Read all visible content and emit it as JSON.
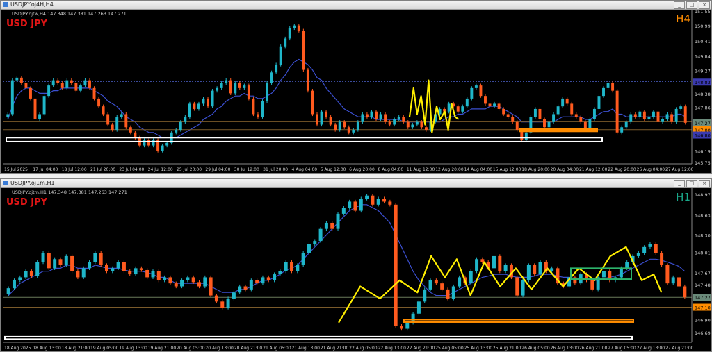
{
  "windows": [
    {
      "title": "USDJPY.oj4H,H4",
      "info": "USDJPY.ojtw,H4  147.348 147.381 147.263 147.271",
      "symbol": "USD JPY",
      "timeframe": "H4",
      "tf_color": "#ff8c00",
      "price_labels": [
        "151.550",
        "150.990",
        "150.410",
        "149.840",
        "149.270",
        "148.830",
        "148.380",
        "147.860",
        "147.310",
        "147.271",
        "147.006",
        "146.800",
        "146.190",
        "145.750"
      ],
      "time_labels": [
        "15 Jul 2025",
        "17 Jul 04:00",
        "18 Jul 12:00",
        "21 Jul 20:00",
        "23 Jul 04:00",
        "24 Jul 12:00",
        "25 Jul 20:00",
        "29 Jul 04:00",
        "30 Jul 12:00",
        "31 Jul 20:00",
        "4 Aug 04:00",
        "5 Aug 12:00",
        "6 Aug 20:00",
        "8 Aug 04:00",
        "11 Aug 12:00",
        "12 Aug 20:00",
        "14 Aug 04:00",
        "15 Aug 12:00",
        "18 Aug 20:00",
        "20 Aug 04:00",
        "21 Aug 12:00",
        "22 Aug 20:00",
        "26 Aug 04:00",
        "27 Aug 12:00"
      ],
      "window_buttons": [
        "_",
        "□",
        "×"
      ]
    },
    {
      "title": "USDJPY.oj1m,H1",
      "info": "USDJPY.ojtm,H1  147.348 147.381 147.263 147.271",
      "symbol": "USD JPY",
      "timeframe": "H1",
      "tf_color": "#1aa88a",
      "price_labels": [
        "148.970",
        "148.630",
        "148.300",
        "148.010",
        "147.675",
        "147.480",
        "147.271",
        "147.106",
        "146.900",
        "146.690"
      ],
      "time_labels": [
        "18 Aug 2025",
        "18 Aug 13:00",
        "18 Aug 21:00",
        "19 Aug 05:00",
        "19 Aug 13:00",
        "19 Aug 21:00",
        "20 Aug 05:00",
        "20 Aug 13:00",
        "20 Aug 21:00",
        "21 Aug 05:00",
        "21 Aug 13:00",
        "21 Aug 21:00",
        "22 Aug 05:00",
        "22 Aug 13:00",
        "22 Aug 21:00",
        "25 Aug 05:00",
        "25 Aug 13:00",
        "25 Aug 21:00",
        "26 Aug 05:00",
        "26 Aug 13:00",
        "26 Aug 21:00",
        "27 Aug 05:00",
        "27 Aug 13:00",
        "27 Aug 21:00"
      ],
      "window_buttons": [
        "_",
        "□",
        "×"
      ]
    }
  ],
  "chart_data": [
    {
      "type": "candlestick",
      "title": "USD JPY",
      "timeframe": "H4",
      "ylim": [
        145.75,
        151.55
      ],
      "closes": [
        147.6,
        148.9,
        149.0,
        148.8,
        148.6,
        148.2,
        147.4,
        147.6,
        148.3,
        148.7,
        148.9,
        148.8,
        148.6,
        148.9,
        148.8,
        148.5,
        148.7,
        148.9,
        148.6,
        148.2,
        147.9,
        147.6,
        147.2,
        147.0,
        147.5,
        147.6,
        147.1,
        146.9,
        146.7,
        146.4,
        146.6,
        146.4,
        146.6,
        146.2,
        146.4,
        146.5,
        146.9,
        147.0,
        147.3,
        147.5,
        148.0,
        147.8,
        148.0,
        148.2,
        147.9,
        148.5,
        148.6,
        148.8,
        148.9,
        148.4,
        148.8,
        148.6,
        148.7,
        148.2,
        147.6,
        147.5,
        148.1,
        148.8,
        149.2,
        149.5,
        150.2,
        150.5,
        150.9,
        151.0,
        150.8,
        149.3,
        148.5,
        147.6,
        147.2,
        147.7,
        147.5,
        147.2,
        147.0,
        147.3,
        147.1,
        146.9,
        147.0,
        147.3,
        147.6,
        147.5,
        147.7,
        147.4,
        147.6,
        147.3,
        147.2,
        147.4,
        147.5,
        147.3,
        147.1,
        147.2,
        147.3,
        147.1,
        147.0,
        147.3,
        147.6,
        147.8,
        147.7,
        148.0,
        147.9,
        147.7,
        147.9,
        148.2,
        148.6,
        148.7,
        148.3,
        148.0,
        147.9,
        148.0,
        147.8,
        147.6,
        147.5,
        147.3,
        147.0,
        146.6,
        146.9,
        147.5,
        147.8,
        147.4,
        147.1,
        147.3,
        147.6,
        147.9,
        148.2,
        148.0,
        147.6,
        147.5,
        147.3,
        147.0,
        147.4,
        147.8,
        148.3,
        148.6,
        148.8,
        148.5,
        146.9,
        147.1,
        147.3,
        147.6,
        147.5,
        147.7,
        147.4,
        147.5,
        147.7,
        147.3,
        147.4,
        147.6,
        147.3,
        147.8,
        147.9,
        147.271
      ],
      "ma": [
        147.4,
        147.9,
        148.3,
        148.5,
        148.6,
        148.6,
        148.5,
        148.4,
        148.4,
        148.4,
        148.5,
        148.5,
        148.6,
        148.6,
        148.6,
        148.6,
        148.6,
        148.6,
        148.6,
        148.5,
        148.4,
        148.3,
        148.1,
        148.0,
        147.9,
        147.7,
        147.5,
        147.4,
        147.3,
        147.1,
        147.0,
        146.9,
        146.9,
        146.8,
        146.7,
        146.7,
        146.7,
        146.7,
        146.8,
        146.9,
        147.0,
        147.1,
        147.2,
        147.4,
        147.5,
        147.6,
        147.8,
        147.9,
        148.1,
        148.2,
        148.3,
        148.3,
        148.4,
        148.3,
        148.3,
        148.2,
        148.2,
        148.3,
        148.4,
        148.6,
        148.9,
        149.1,
        149.4,
        149.6,
        149.7,
        149.6,
        149.5,
        149.3,
        149.0,
        148.9,
        148.6,
        148.4,
        148.2,
        148.0,
        147.8,
        147.7,
        147.6,
        147.5,
        147.5,
        147.5,
        147.5,
        147.4,
        147.4,
        147.4,
        147.4,
        147.4,
        147.4,
        147.3,
        147.3,
        147.3,
        147.3,
        147.3,
        147.3,
        147.3,
        147.3,
        147.3,
        147.4,
        147.5,
        147.5,
        147.6,
        147.6,
        147.7,
        147.8,
        147.8,
        147.8,
        147.8,
        147.9,
        147.9,
        147.9,
        147.8,
        147.7,
        147.6,
        147.5,
        147.3,
        147.3,
        147.3,
        147.3,
        147.3,
        147.3,
        147.3,
        147.3,
        147.4,
        147.5,
        147.5,
        147.5,
        147.5,
        147.5,
        147.4,
        147.4,
        147.5,
        147.6,
        147.7,
        147.7,
        147.8,
        147.6,
        147.6,
        147.5,
        147.5,
        147.5,
        147.5,
        147.5,
        147.5,
        147.5,
        147.5,
        147.5,
        147.5,
        147.5,
        147.6,
        147.6,
        147.5
      ],
      "zigzag": [
        [
          147.35,
          147.5
        ],
        [
          147.7,
          148.6
        ],
        [
          148.0,
          147.6
        ],
        [
          148.35,
          148.3
        ],
        [
          148.7,
          147.2
        ],
        [
          149.0,
          148.9
        ],
        [
          149.3,
          146.9
        ],
        [
          149.7,
          147.9
        ],
        [
          150.0,
          147.4
        ],
        [
          150.4,
          147.7
        ],
        [
          150.7,
          147.0
        ],
        [
          151.0,
          148.0
        ],
        [
          151.3,
          147.5
        ],
        [
          151.6,
          147.4
        ]
      ],
      "hlines": [
        {
          "y": 148.85,
          "style": "dashed",
          "color": "#3a4a9a"
        },
        {
          "y": 147.31,
          "color": "#7a5a2a"
        },
        {
          "y": 147.006,
          "color": "#7a5a2a"
        },
        {
          "y": 146.8,
          "color": "#3a3aa0"
        }
      ],
      "rects": [
        {
          "color": "#ffffff",
          "y1": 146.55,
          "y2": 146.7
        },
        {
          "color": "#ff8c00",
          "y1": 146.94,
          "y2": 147.03
        }
      ]
    },
    {
      "type": "candlestick",
      "title": "USD JPY",
      "timeframe": "H1",
      "ylim": [
        146.55,
        149.05
      ],
      "closes": [
        147.42,
        147.55,
        147.6,
        147.7,
        147.62,
        147.85,
        148.0,
        147.75,
        147.9,
        147.8,
        147.95,
        147.7,
        147.6,
        147.75,
        147.85,
        148.0,
        147.8,
        147.7,
        147.75,
        147.85,
        147.7,
        147.65,
        147.75,
        147.72,
        147.6,
        147.7,
        147.55,
        147.6,
        147.5,
        147.45,
        147.55,
        147.6,
        147.52,
        147.45,
        147.6,
        147.3,
        147.2,
        147.1,
        147.25,
        147.35,
        147.45,
        147.4,
        147.55,
        147.5,
        147.6,
        147.55,
        147.65,
        147.7,
        147.85,
        147.7,
        147.8,
        148.0,
        148.15,
        148.2,
        148.4,
        148.5,
        148.4,
        148.65,
        148.75,
        148.85,
        148.7,
        148.9,
        148.95,
        148.8,
        148.9,
        148.85,
        148.8,
        146.8,
        146.75,
        146.85,
        147.0,
        147.2,
        147.4,
        147.55,
        147.5,
        147.4,
        147.25,
        147.45,
        147.6,
        147.5,
        147.7,
        147.9,
        147.85,
        147.75,
        147.95,
        147.7,
        147.8,
        147.6,
        147.3,
        147.55,
        147.8,
        147.65,
        147.85,
        147.7,
        147.75,
        147.5,
        147.45,
        147.6,
        147.5,
        147.65,
        147.55,
        147.4,
        147.6,
        147.7,
        147.55,
        147.6,
        147.75,
        147.85,
        147.95,
        148.0,
        148.1,
        148.15,
        148.0,
        147.8,
        147.5,
        147.6,
        147.45,
        147.271
      ],
      "ma": [
        147.3,
        147.4,
        147.5,
        147.55,
        147.6,
        147.65,
        147.7,
        147.7,
        147.75,
        147.75,
        147.8,
        147.8,
        147.75,
        147.75,
        147.75,
        147.8,
        147.78,
        147.75,
        147.75,
        147.75,
        147.72,
        147.7,
        147.7,
        147.7,
        147.68,
        147.65,
        147.6,
        147.6,
        147.55,
        147.5,
        147.5,
        147.5,
        147.5,
        147.5,
        147.5,
        147.45,
        147.4,
        147.35,
        147.35,
        147.35,
        147.4,
        147.4,
        147.45,
        147.5,
        147.55,
        147.55,
        147.6,
        147.65,
        147.72,
        147.75,
        147.8,
        147.9,
        148.0,
        148.1,
        148.2,
        148.3,
        148.4,
        148.5,
        148.6,
        148.7,
        148.75,
        148.8,
        148.8,
        148.75,
        148.7,
        148.6,
        148.5,
        148.3,
        148.1,
        147.9,
        147.7,
        147.55,
        147.45,
        147.35,
        147.3,
        147.3,
        147.3,
        147.35,
        147.4,
        147.45,
        147.5,
        147.55,
        147.6,
        147.62,
        147.65,
        147.65,
        147.65,
        147.62,
        147.6,
        147.6,
        147.6,
        147.62,
        147.65,
        147.65,
        147.65,
        147.62,
        147.6,
        147.6,
        147.58,
        147.58,
        147.58,
        147.55,
        147.55,
        147.58,
        147.6,
        147.62,
        147.65,
        147.7,
        147.75,
        147.8,
        147.85,
        147.9,
        147.9,
        147.88,
        147.85,
        147.82,
        147.78,
        147.7
      ],
      "zigzag": [
        [
          8.0,
          146.85
        ],
        [
          8.55,
          147.45
        ],
        [
          9.05,
          147.25
        ],
        [
          9.55,
          147.55
        ],
        [
          10.0,
          147.35
        ],
        [
          10.35,
          147.95
        ],
        [
          10.7,
          147.6
        ],
        [
          11.0,
          147.9
        ],
        [
          11.35,
          147.3
        ],
        [
          11.7,
          147.85
        ],
        [
          12.1,
          147.45
        ],
        [
          12.5,
          147.75
        ],
        [
          12.9,
          147.4
        ],
        [
          13.3,
          147.75
        ],
        [
          13.7,
          147.45
        ],
        [
          14.1,
          147.75
        ],
        [
          14.5,
          147.55
        ],
        [
          14.9,
          147.95
        ],
        [
          15.3,
          148.1
        ],
        [
          15.7,
          147.55
        ],
        [
          16.0,
          147.65
        ],
        [
          16.2,
          147.35
        ]
      ],
      "hlines": [
        {
          "y": 147.27,
          "color": "#6a7a5a"
        },
        {
          "y": 147.106,
          "color": "#7a5a2a"
        }
      ],
      "rects": [
        {
          "color": "#ffffff",
          "y1": 146.58,
          "y2": 146.62
        },
        {
          "color": "#ff8c00",
          "y1": 146.86,
          "y2": 146.9
        },
        {
          "color": "#2db36b",
          "y1": 147.57,
          "y2": 147.75
        }
      ]
    }
  ]
}
